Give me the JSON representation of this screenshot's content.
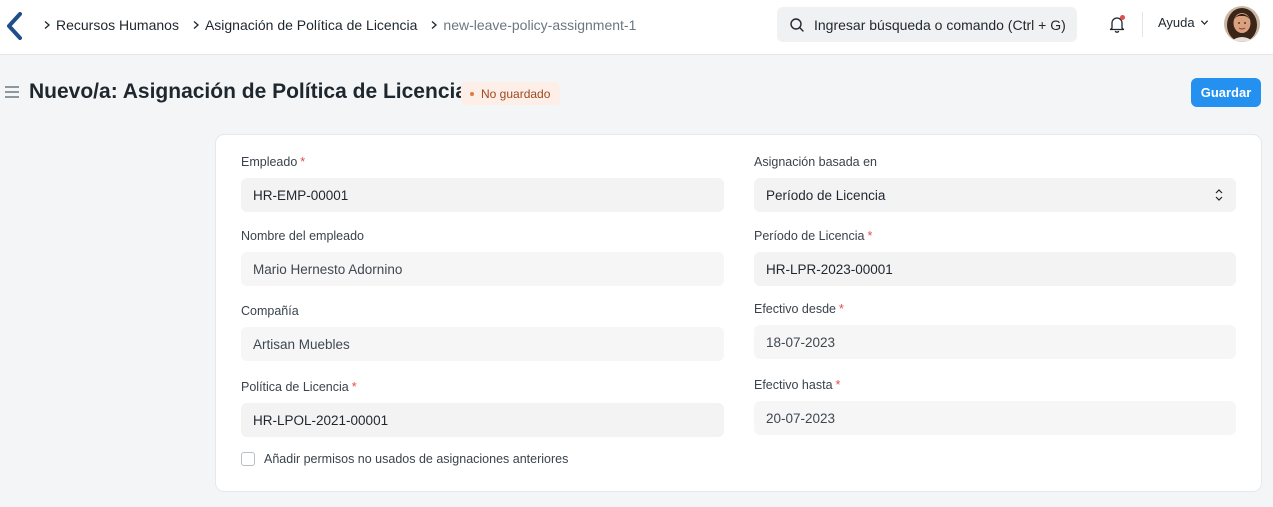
{
  "breadcrumb": {
    "items": [
      "Recursos Humanos",
      "Asignación de Política de Licencia",
      "new-leave-policy-assignment-1"
    ]
  },
  "search": {
    "placeholder": "Ingresar búsqueda o comando (Ctrl + G)"
  },
  "header": {
    "help_label": "Ayuda"
  },
  "page": {
    "title": "Nuevo/a: Asignación de Política de Licencia",
    "status": "No guardado",
    "save_label": "Guardar"
  },
  "form": {
    "employee": {
      "label": "Empleado",
      "value": "HR-EMP-00001"
    },
    "employee_name": {
      "label": "Nombre del empleado",
      "value": "Mario Hernesto Adornino"
    },
    "company": {
      "label": "Compañía",
      "value": "Artisan Muebles"
    },
    "leave_policy": {
      "label": "Política de Licencia",
      "value": "HR-LPOL-2021-00001"
    },
    "assignment_based_on": {
      "label": "Asignación basada en",
      "value": "Período de Licencia"
    },
    "leave_period": {
      "label": "Período de Licencia",
      "value": "HR-LPR-2023-00001"
    },
    "effective_from": {
      "label": "Efectivo desde",
      "value": "18-07-2023"
    },
    "effective_to": {
      "label": "Efectivo hasta",
      "value": "20-07-2023"
    },
    "carry_forward": {
      "label": "Añadir permisos no usados de asignaciones anteriores",
      "checked": false
    }
  },
  "colors": {
    "primary": "#2490ef",
    "required": "#e24c4c",
    "badge_bg": "#fdeee7",
    "badge_text": "#9b4a1f"
  },
  "icons": [
    "app-logo-icon",
    "chevron-right-icon",
    "search-icon",
    "bell-icon",
    "chevron-down-icon",
    "hamburger-icon",
    "select-arrows-icon"
  ]
}
